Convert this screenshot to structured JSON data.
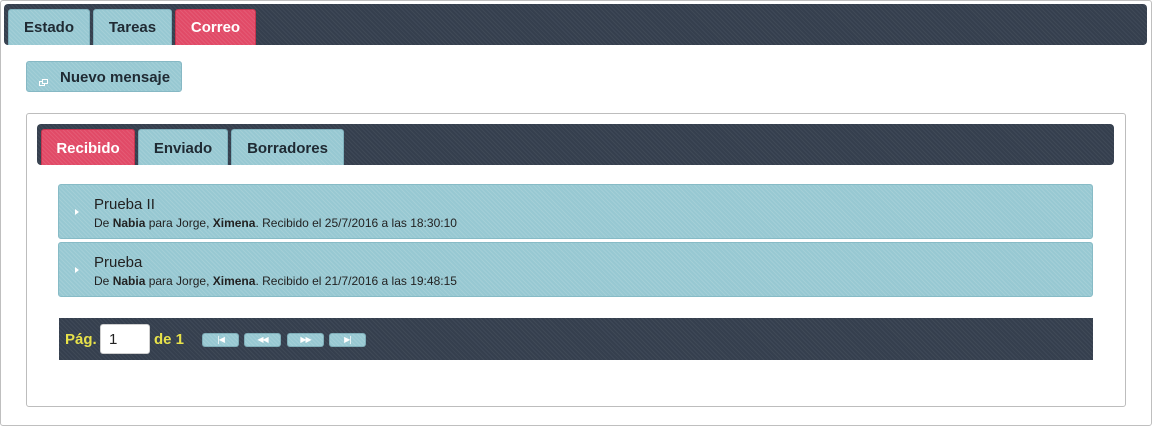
{
  "main_tabs": [
    {
      "label": "Estado",
      "active": false
    },
    {
      "label": "Tareas",
      "active": false
    },
    {
      "label": "Correo",
      "active": true
    }
  ],
  "new_message_button": {
    "label": "Nuevo mensaje",
    "icon": "new-window-icon"
  },
  "mail_tabs": [
    {
      "label": "Recibido",
      "active": true
    },
    {
      "label": "Enviado",
      "active": false
    },
    {
      "label": "Borradores",
      "active": false
    }
  ],
  "messages": [
    {
      "subject": "Prueba II",
      "from_prefix": "De ",
      "from": "Nabia",
      "to_prefix": " para Jorge, ",
      "to_bold": "Ximena",
      "received": ". Recibido el 25/7/2016 a las 18:30:10"
    },
    {
      "subject": "Prueba",
      "from_prefix": "De ",
      "from": "Nabia",
      "to_prefix": " para Jorge, ",
      "to_bold": "Ximena",
      "received": ". Recibido el 21/7/2016 a las 19:48:15"
    }
  ],
  "pager": {
    "page_label": "Pág.",
    "page_value": "1",
    "of_label": "de 1",
    "buttons": [
      {
        "name": "first-page",
        "glyph": "|◀"
      },
      {
        "name": "previous-page",
        "glyph": "◀◀"
      },
      {
        "name": "next-page",
        "glyph": "▶▶"
      },
      {
        "name": "last-page",
        "glyph": "▶|"
      }
    ]
  },
  "colors": {
    "dark_bar": "#353f4e",
    "tab_blue": "#97c8d2",
    "tab_active": "#e14a67",
    "pager_text": "#e8e24a"
  }
}
